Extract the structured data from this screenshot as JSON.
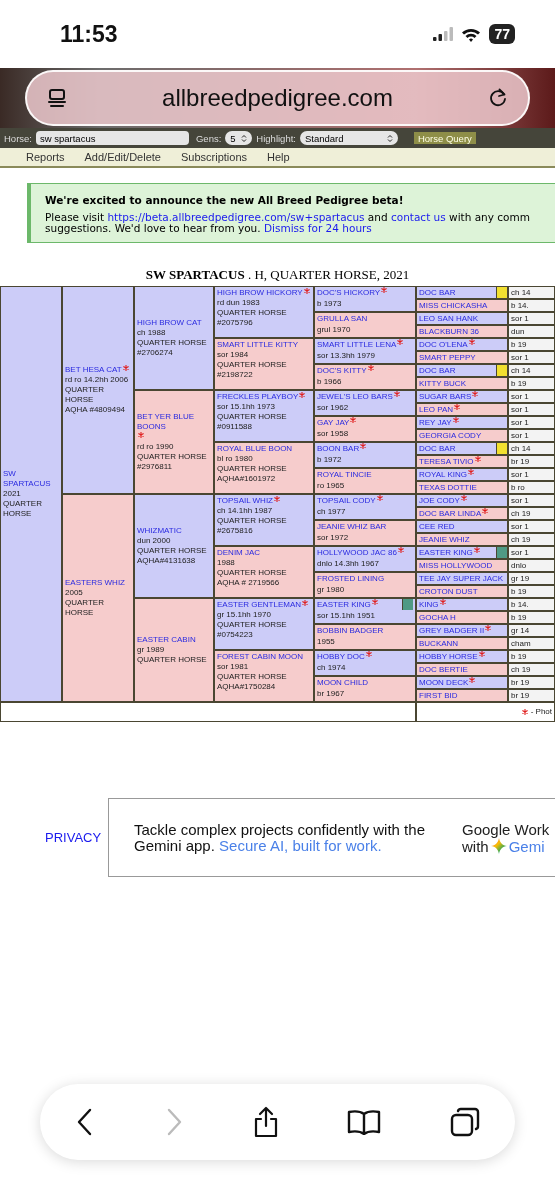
{
  "status_bar": {
    "time": "11:53",
    "battery": "77"
  },
  "browser": {
    "url": "allbreedpedigree.com"
  },
  "search_form": {
    "horse_label": "Horse:",
    "horse_value": "sw spartacus",
    "gens_label": "Gens:",
    "gens_value": "5",
    "highlight_label": "Highlight:",
    "highlight_value": "Standard",
    "submit": "Horse Query"
  },
  "menu": [
    "Reports",
    "Add/Edit/Delete",
    "Subscriptions",
    "Help"
  ],
  "announcement": {
    "title": "We're excited to announce the new All Breed Pedigree beta!",
    "lines": [
      [
        {
          "kind": "text",
          "text": "Please visit "
        },
        {
          "kind": "link",
          "text": "https://beta.allbreedpedigree.com/sw+spartacus"
        },
        {
          "kind": "text",
          "text": " and "
        },
        {
          "kind": "link",
          "text": "contact us"
        },
        {
          "kind": "text",
          "text": " with any comm"
        }
      ],
      [
        {
          "kind": "text",
          "text": "suggestions. We'd love to hear from you. "
        },
        {
          "kind": "link",
          "text": "Dismiss for 24 hours"
        }
      ]
    ]
  },
  "pedigree": {
    "title": "**SW SPARTACUS** . H, QUARTER HORSE, 2021",
    "legend": "- Phot",
    "horse": {
      "name": "SW SPARTACUS",
      "male": true,
      "photo": false,
      "details": [
        "2021",
        "QUARTER HORSE"
      ],
      "children": [
        {
          "name": "BET HESA CAT",
          "male": true,
          "photo": true,
          "details": [
            "rd ro 14.2hh 2006",
            "QUARTER HORSE",
            "AQHA #4809494"
          ],
          "children": [
            {
              "name": "HIGH BROW CAT",
              "male": true,
              "photo": false,
              "details": [
                "ch 1988",
                "QUARTER HORSE",
                "#2706274"
              ],
              "children": [
                {
                  "name": "HIGH BROW HICKORY",
                  "male": true,
                  "photo": true,
                  "details": [
                    "rd dun 1983",
                    "QUARTER HORSE",
                    "#2075796"
                  ],
                  "children": [
                    {
                      "name": "DOC'S HICKORY",
                      "male": true,
                      "photo": true,
                      "details": [
                        "b 1973"
                      ],
                      "children": [
                        {
                          "name": "DOC BAR",
                          "male": true,
                          "photo": false,
                          "color": "#f2e030",
                          "details": [
                            "ch 14"
                          ]
                        },
                        {
                          "name": "MISS CHICKASHA",
                          "male": false,
                          "photo": false,
                          "details": [
                            "b 14."
                          ]
                        }
                      ]
                    },
                    {
                      "name": "GRULLA SAN",
                      "male": false,
                      "photo": false,
                      "details": [
                        "grul 1970"
                      ],
                      "children": [
                        {
                          "name": "LEO SAN HANK",
                          "male": true,
                          "photo": false,
                          "details": [
                            "sor 1"
                          ]
                        },
                        {
                          "name": "BLACKBURN 36",
                          "male": false,
                          "photo": false,
                          "details": [
                            "dun"
                          ]
                        }
                      ]
                    }
                  ]
                },
                {
                  "name": "SMART LITTLE KITTY",
                  "male": false,
                  "photo": false,
                  "details": [
                    "sor 1984",
                    "QUARTER HORSE",
                    "#2198722"
                  ],
                  "children": [
                    {
                      "name": "SMART LITTLE LENA",
                      "male": true,
                      "photo": true,
                      "details": [
                        "sor 13.3hh 1979"
                      ],
                      "children": [
                        {
                          "name": "DOC O'LENA",
                          "male": true,
                          "photo": true,
                          "details": [
                            "b 19"
                          ]
                        },
                        {
                          "name": "SMART PEPPY",
                          "male": false,
                          "photo": false,
                          "details": [
                            "sor 1"
                          ]
                        }
                      ]
                    },
                    {
                      "name": "DOC'S KITTY",
                      "male": false,
                      "photo": true,
                      "details": [
                        "b 1966"
                      ],
                      "children": [
                        {
                          "name": "DOC BAR",
                          "male": true,
                          "photo": false,
                          "color": "#f2e030",
                          "details": [
                            "ch 14"
                          ]
                        },
                        {
                          "name": "KITTY BUCK",
                          "male": false,
                          "photo": false,
                          "details": [
                            "b 19"
                          ]
                        }
                      ]
                    }
                  ]
                }
              ]
            },
            {
              "name": "BET YER BLUE BOONS",
              "male": false,
              "photo": true,
              "details": [
                "rd ro 1990",
                "QUARTER HORSE",
                "#2976811"
              ],
              "children": [
                {
                  "name": "FRECKLES PLAYBOY",
                  "male": true,
                  "photo": true,
                  "details": [
                    "sor 15.1hh 1973",
                    "QUARTER HORSE",
                    "#0911588"
                  ],
                  "children": [
                    {
                      "name": "JEWEL'S LEO BARS",
                      "male": true,
                      "photo": true,
                      "details": [
                        "sor 1962"
                      ],
                      "children": [
                        {
                          "name": "SUGAR BARS",
                          "male": true,
                          "photo": true,
                          "details": [
                            "sor 1"
                          ]
                        },
                        {
                          "name": "LEO PAN",
                          "male": false,
                          "photo": true,
                          "details": [
                            "sor 1"
                          ]
                        }
                      ]
                    },
                    {
                      "name": "GAY JAY",
                      "male": false,
                      "photo": true,
                      "details": [
                        "sor 1958"
                      ],
                      "children": [
                        {
                          "name": "REY JAY",
                          "male": true,
                          "photo": true,
                          "details": [
                            "sor 1"
                          ]
                        },
                        {
                          "name": "GEORGIA CODY",
                          "male": false,
                          "photo": false,
                          "details": [
                            "sor 1"
                          ]
                        }
                      ]
                    }
                  ]
                },
                {
                  "name": "ROYAL BLUE BOON",
                  "male": false,
                  "photo": false,
                  "details": [
                    "bl ro 1980",
                    "QUARTER HORSE",
                    "AQHA#1601972"
                  ],
                  "children": [
                    {
                      "name": "BOON BAR",
                      "male": true,
                      "photo": true,
                      "details": [
                        "b 1972"
                      ],
                      "children": [
                        {
                          "name": "DOC BAR",
                          "male": true,
                          "photo": false,
                          "color": "#f2e030",
                          "details": [
                            "ch 14"
                          ]
                        },
                        {
                          "name": "TERESA TIVIO",
                          "male": false,
                          "photo": true,
                          "details": [
                            "br 19"
                          ]
                        }
                      ]
                    },
                    {
                      "name": "ROYAL TINCIE",
                      "male": false,
                      "photo": false,
                      "details": [
                        "ro 1965"
                      ],
                      "children": [
                        {
                          "name": "ROYAL KING",
                          "male": true,
                          "photo": true,
                          "details": [
                            "sor 1"
                          ]
                        },
                        {
                          "name": "TEXAS DOTTIE",
                          "male": false,
                          "photo": false,
                          "details": [
                            "b ro"
                          ]
                        }
                      ]
                    }
                  ]
                }
              ]
            }
          ]
        },
        {
          "name": "EASTERS WHIZ",
          "male": false,
          "photo": false,
          "details": [
            "2005",
            "QUARTER HORSE"
          ],
          "children": [
            {
              "name": "WHIZMATIC",
              "male": true,
              "photo": false,
              "details": [
                "dun 2000",
                "QUARTER HORSE",
                "AQHA#4131638"
              ],
              "children": [
                {
                  "name": "TOPSAIL WHIZ",
                  "male": true,
                  "photo": true,
                  "details": [
                    "ch 14.1hh 1987",
                    "QUARTER HORSE",
                    "#2675816"
                  ],
                  "children": [
                    {
                      "name": "TOPSAIL CODY",
                      "male": true,
                      "photo": true,
                      "details": [
                        "ch 1977"
                      ],
                      "children": [
                        {
                          "name": "JOE CODY",
                          "male": true,
                          "photo": true,
                          "details": [
                            "sor 1"
                          ]
                        },
                        {
                          "name": "DOC BAR LINDA",
                          "male": false,
                          "photo": true,
                          "details": [
                            "ch 19"
                          ]
                        }
                      ]
                    },
                    {
                      "name": "JEANIE WHIZ BAR",
                      "male": false,
                      "photo": false,
                      "details": [
                        "sor 1972"
                      ],
                      "children": [
                        {
                          "name": "CEE RED",
                          "male": true,
                          "photo": false,
                          "details": [
                            "sor 1"
                          ]
                        },
                        {
                          "name": "JEANIE WHIZ",
                          "male": false,
                          "photo": false,
                          "details": [
                            "ch 19"
                          ]
                        }
                      ]
                    }
                  ]
                },
                {
                  "name": "DENIM JAC",
                  "male": false,
                  "photo": false,
                  "details": [
                    "1988",
                    "QUARTER HORSE",
                    "AQHA # 2719566"
                  ],
                  "children": [
                    {
                      "name": "HOLLYWOOD JAC 86",
                      "male": true,
                      "photo": true,
                      "details": [
                        "dnlo 14.3hh 1967"
                      ],
                      "children": [
                        {
                          "name": "EASTER KING",
                          "male": true,
                          "photo": true,
                          "color": "#4f9a85",
                          "details": [
                            "sor 1"
                          ]
                        },
                        {
                          "name": "MISS HOLLYWOOD",
                          "male": false,
                          "photo": false,
                          "details": [
                            "dnlo"
                          ]
                        }
                      ]
                    },
                    {
                      "name": "FROSTED LINING",
                      "male": false,
                      "photo": false,
                      "details": [
                        "gr 1980"
                      ],
                      "children": [
                        {
                          "name": "TEE JAY SUPER JACK",
                          "male": true,
                          "photo": false,
                          "details": [
                            "gr 19"
                          ]
                        },
                        {
                          "name": "CROTON DUST",
                          "male": false,
                          "photo": false,
                          "details": [
                            "b 19"
                          ]
                        }
                      ]
                    }
                  ]
                }
              ]
            },
            {
              "name": "EASTER CABIN",
              "male": false,
              "photo": false,
              "details": [
                "gr 1989",
                "QUARTER HORSE"
              ],
              "children": [
                {
                  "name": "EASTER GENTLEMAN",
                  "male": true,
                  "photo": true,
                  "details": [
                    "gr 15.1hh 1970",
                    "QUARTER HORSE",
                    "#0754223"
                  ],
                  "children": [
                    {
                      "name": "EASTER KING",
                      "male": true,
                      "photo": true,
                      "color": "#4f9a85",
                      "details": [
                        "sor 15.1hh 1951"
                      ],
                      "children": [
                        {
                          "name": "KING",
                          "male": true,
                          "photo": true,
                          "details": [
                            "b 14."
                          ]
                        },
                        {
                          "name": "GOCHA H",
                          "male": false,
                          "photo": false,
                          "details": [
                            "b 19"
                          ]
                        }
                      ]
                    },
                    {
                      "name": "BOBBIN BADGER",
                      "male": false,
                      "photo": false,
                      "details": [
                        "1955"
                      ],
                      "children": [
                        {
                          "name": "GREY BADGER II",
                          "male": true,
                          "photo": true,
                          "details": [
                            "gr 14"
                          ]
                        },
                        {
                          "name": "BUCKANN",
                          "male": false,
                          "photo": false,
                          "details": [
                            "cham"
                          ]
                        }
                      ]
                    }
                  ]
                },
                {
                  "name": "FOREST CABIN MOON",
                  "male": false,
                  "photo": false,
                  "details": [
                    "sor 1981",
                    "QUARTER HORSE",
                    "AQHA#1750284"
                  ],
                  "children": [
                    {
                      "name": "HOBBY DOC",
                      "male": true,
                      "photo": true,
                      "details": [
                        "ch 1974"
                      ],
                      "children": [
                        {
                          "name": "HOBBY HORSE",
                          "male": true,
                          "photo": true,
                          "details": [
                            "b 19"
                          ]
                        },
                        {
                          "name": "DOC BERTIE",
                          "male": false,
                          "photo": false,
                          "details": [
                            "ch 19"
                          ]
                        }
                      ]
                    },
                    {
                      "name": "MOON CHILD",
                      "male": false,
                      "photo": false,
                      "details": [
                        "br 1967"
                      ],
                      "children": [
                        {
                          "name": "MOON DECK",
                          "male": true,
                          "photo": true,
                          "details": [
                            "br 19"
                          ]
                        },
                        {
                          "name": "FIRST BID",
                          "male": false,
                          "photo": false,
                          "details": [
                            "br 19"
                          ]
                        }
                      ]
                    }
                  ]
                }
              ]
            }
          ]
        }
      ]
    }
  },
  "footer": {
    "privacy": "PRIVACY"
  },
  "ad": {
    "text": "Tackle complex projects confidently with the Gemini app.",
    "highlight": "Secure AI, built for work.",
    "brand_line1": "Google Work",
    "brand_line2": "with",
    "brand_name": "Gemi"
  }
}
